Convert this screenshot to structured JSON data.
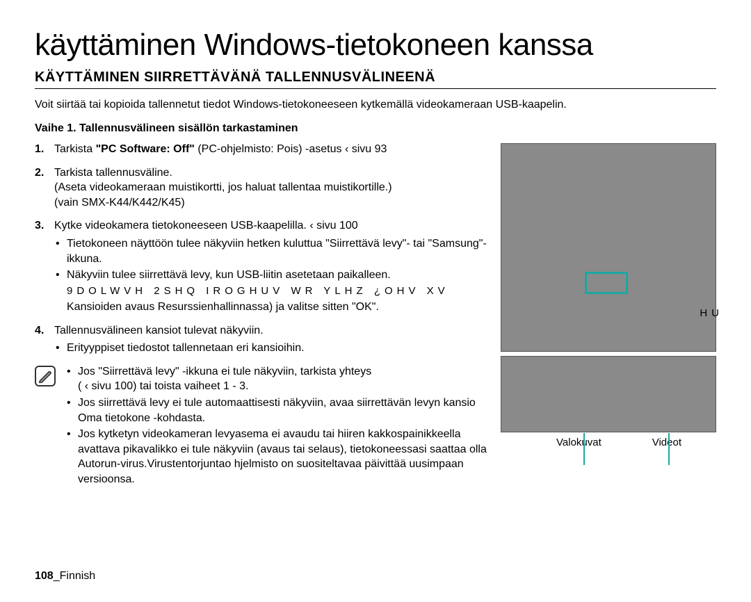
{
  "title": "käyttäminen Windows-tietokoneen kanssa",
  "subtitle": "KÄYTTÄMINEN SIIRRETTÄVÄNÄ TALLENNUSVÄLINEENÄ",
  "intro": "Voit siirtää tai kopioida tallennetut tiedot Windows-tietokoneeseen kytkemällä videokameraan USB-kaapelin.",
  "step1_title": "Vaihe 1. Tallennusvälineen sisällön tarkastaminen",
  "items": {
    "n1": "1.",
    "t1a": "Tarkista ",
    "t1b": "\"PC Software: Off\"",
    "t1c": " (PC-ohjelmisto: Pois) -asetus  ‹  sivu 93",
    "n2": "2.",
    "t2a": "Tarkista tallennusväline.",
    "t2b": "(Aseta videokameraan muistikortti, jos haluat tallentaa muistikortille.)",
    "t2c": "(vain SMX-K44/K442/K45)",
    "n3": "3.",
    "t3": "Kytke videokamera tietokoneeseen USB-kaapelilla.  ‹  sivu 100",
    "s3a": "Tietokoneen näyttöön tulee näkyviin hetken kuluttua \"Siirrettävä levy\"- tai \"Samsung\"-ikkuna.",
    "s3b": "Näkyviin tulee siirrettävä levy, kun USB-liitin asetetaan paikalleen.",
    "garbled": "9DOLWVH 2SHQ IROGHUV WR YLHZ ¿OHV XV",
    "s3c": "Kansioiden avaus Resurssienhallinnassa) ja valitse sitten \"OK\".",
    "n4": "4.",
    "t4": "Tallennusvälineen kansiot tulevat näkyviin.",
    "s4a": "Erityyppiset tiedostot tallennetaan eri kansioihin."
  },
  "notes": {
    "a": "Jos \"Siirrettävä levy\" -ikkuna ei tule näkyviin, tarkista yhteys",
    "a2": "(  ‹  sivu 100) tai toista vaiheet 1 - 3.",
    "b": "Jos siirrettävä levy ei tule automaattisesti näkyviin, avaa siirrettävän levyn kansio Oma tietokone -kohdasta.",
    "c": "Jos kytketyn videokameran levyasema ei avaudu tai hiiren kakkospainikkeella avattava pikavalikko ei tule näkyviin (avaus tai selaus), tietokoneessasi saattaa olla Autorun-virus.Virustentorjuntao hjelmisto on suositeltavaa päivittää uusimpaan versioonsa."
  },
  "garbled_tail": "HU",
  "captions": {
    "photos": "Valokuvat",
    "videos": "Videot"
  },
  "footer": {
    "page": "108",
    "sep": "_",
    "lang": "Finnish"
  }
}
